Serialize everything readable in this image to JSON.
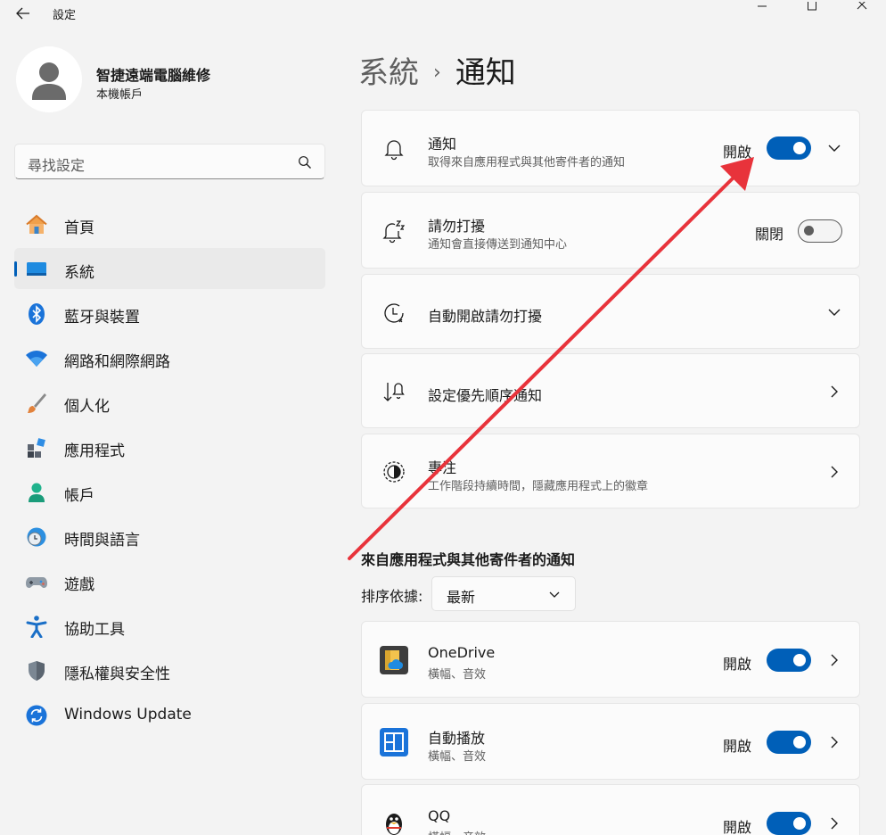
{
  "window": {
    "title": "設定",
    "icons": {
      "back": "back-arrow-icon",
      "minimize": "minimize-icon",
      "maximize": "maximize-icon",
      "close": "close-icon"
    }
  },
  "profile": {
    "name": "智捷遠端電腦維修",
    "account_type": "本機帳戶"
  },
  "search": {
    "placeholder": "尋找設定"
  },
  "sidebar": {
    "items": [
      {
        "label": "首頁",
        "icon": "home-icon",
        "active": false
      },
      {
        "label": "系統",
        "icon": "system-icon",
        "active": true
      },
      {
        "label": "藍牙與裝置",
        "icon": "bluetooth-icon",
        "active": false
      },
      {
        "label": "網路和網際網路",
        "icon": "wifi-icon",
        "active": false
      },
      {
        "label": "個人化",
        "icon": "brush-icon",
        "active": false
      },
      {
        "label": "應用程式",
        "icon": "apps-icon",
        "active": false
      },
      {
        "label": "帳戶",
        "icon": "account-icon",
        "active": false
      },
      {
        "label": "時間與語言",
        "icon": "time-language-icon",
        "active": false
      },
      {
        "label": "遊戲",
        "icon": "gamepad-icon",
        "active": false
      },
      {
        "label": "協助工具",
        "icon": "accessibility-icon",
        "active": false
      },
      {
        "label": "隱私權與安全性",
        "icon": "shield-icon",
        "active": false
      },
      {
        "label": "Windows Update",
        "icon": "update-icon",
        "active": false
      }
    ]
  },
  "breadcrumb": {
    "parent": "系統",
    "separator": "›",
    "current": "通知"
  },
  "settings": {
    "notifications": {
      "title": "通知",
      "subtitle": "取得來自應用程式與其他寄件者的通知",
      "state": "開啟",
      "on": true,
      "icon": "bell-icon"
    },
    "dnd": {
      "title": "請勿打擾",
      "subtitle": "通知會直接傳送到通知中心",
      "state": "關閉",
      "on": false,
      "icon": "bell-snooze-icon"
    },
    "auto_dnd": {
      "title": "自動開啟請勿打擾",
      "icon": "clock-icon"
    },
    "priority": {
      "title": "設定優先順序通知",
      "icon": "priority-icon"
    },
    "focus": {
      "title": "專注",
      "subtitle": "工作階段持續時間，隱藏應用程式上的徽章",
      "icon": "focus-icon"
    }
  },
  "app_section": {
    "title": "來自應用程式與其他寄件者的通知",
    "sort_label": "排序依據:",
    "sort_value": "最新",
    "apps": [
      {
        "name": "OneDrive",
        "detail": "橫幅、音效",
        "state": "開啟",
        "on": true,
        "icon": "onedrive-icon"
      },
      {
        "name": "自動播放",
        "detail": "橫幅、音效",
        "state": "開啟",
        "on": true,
        "icon": "autoplay-icon"
      },
      {
        "name": "QQ",
        "detail": "橫幅、音效",
        "state": "開啟",
        "on": true,
        "icon": "qq-penguin-icon"
      }
    ]
  },
  "colors": {
    "accent": "#005fb8",
    "annotation_arrow": "#e8333b",
    "window_bg": "#f3f3f3",
    "card_bg": "#fbfbfb"
  }
}
